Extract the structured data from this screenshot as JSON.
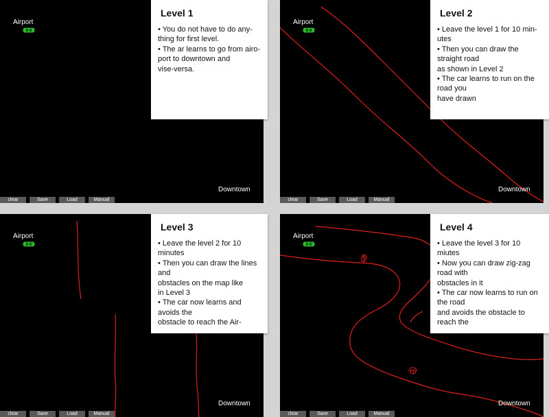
{
  "panels": [
    {
      "airport_label": "Airport",
      "downtown_label": "Downtown",
      "buttons": {
        "clear": "clear",
        "save": "Save",
        "load": "Load",
        "manual": "Manual"
      }
    },
    {
      "airport_label": "Airport",
      "downtown_label": "Downtown",
      "buttons": {
        "clear": "clear",
        "save": "Save",
        "load": "Load",
        "manual": "Manual"
      }
    },
    {
      "airport_label": "Airport",
      "downtown_label": "Downtown",
      "buttons": {
        "clear": "clear",
        "save": "Save",
        "load": "Load",
        "manual": "Manual"
      }
    },
    {
      "airport_label": "Airport",
      "downtown_label": "Downtown",
      "buttons": {
        "clear": "clear",
        "save": "Save",
        "load": "Load",
        "manual": "Manual"
      }
    }
  ],
  "notes": [
    {
      "title": "Level 1",
      "lines": [
        "•  You do not have to do any-",
        "   thing for first level.",
        "•  The ar learns to go from airo-",
        "   port to downtown and",
        "   vise-versa."
      ]
    },
    {
      "title": "Level 2",
      "lines": [
        "•  Leave the level 1 for 10 min-",
        "   utes",
        "•  Then you can draw the",
        "   straight road",
        "      as shown in Level 2",
        "•  The car learns to run on the",
        "   road you",
        "      have drawn"
      ]
    },
    {
      "title": "Level 3",
      "lines": [
        "•  Leave the level 2 for 10",
        "   minutes",
        "•  Then you can draw the lines",
        "   and",
        "      obstacles on the map like",
        "   in Level 3",
        "•  The car now learns and",
        "   avoids the",
        "      obstacle to reach the Air-"
      ]
    },
    {
      "title": "Level 4",
      "lines": [
        "•  Leave the level 3 for 10",
        "   miutes",
        "•  Now you can draw zig-zag",
        "   road with",
        "      obstacles in it",
        "•  The car now learns to run on",
        "   the road",
        "      and avoids the obstacle to",
        "   reach the"
      ]
    }
  ],
  "colors": {
    "map_bg": "#000000",
    "road_line": "#e0201c",
    "car": "#2db52d",
    "button_bg": "#595959",
    "page_bg": "#d4d4d4"
  },
  "icons": {
    "car": "car-icon"
  }
}
